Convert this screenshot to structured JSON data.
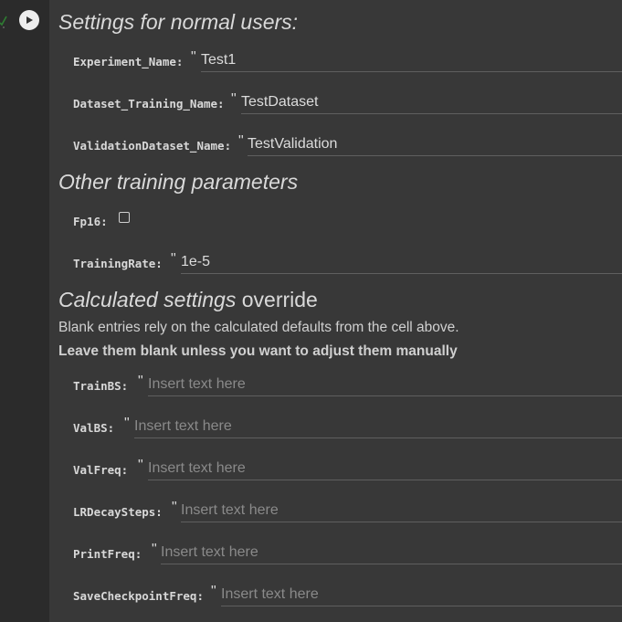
{
  "headings": {
    "normal_settings": "Settings for normal users:",
    "training_params": "Other training parameters",
    "calculated_italic": "Calculated settings",
    "calculated_plain": " override"
  },
  "descriptions": {
    "blank_entries": "Blank entries rely on the calculated defaults from the cell above.",
    "leave_blank": "Leave them blank unless you want to adjust them manually"
  },
  "quote_mark": "\"",
  "fields": {
    "experiment_name": {
      "label": "Experiment_Name:",
      "value": "Test1"
    },
    "dataset_training_name": {
      "label": "Dataset_Training_Name:",
      "value": "TestDataset"
    },
    "validation_dataset_name": {
      "label": "ValidationDataset_Name:",
      "value": "TestValidation"
    },
    "fp16": {
      "label": "Fp16:",
      "checked": false
    },
    "training_rate": {
      "label": "TrainingRate:",
      "value": "1e-5"
    },
    "train_bs": {
      "label": "TrainBS:",
      "value": "",
      "placeholder": "Insert text here"
    },
    "val_bs": {
      "label": "ValBS:",
      "value": "",
      "placeholder": "Insert text here"
    },
    "val_freq": {
      "label": "ValFreq:",
      "value": "",
      "placeholder": "Insert text here"
    },
    "lr_decay_steps": {
      "label": "LRDecaySteps:",
      "value": "",
      "placeholder": "Insert text here"
    },
    "print_freq": {
      "label": "PrintFreq:",
      "value": "",
      "placeholder": "Insert text here"
    },
    "save_checkpoint_freq": {
      "label": "SaveCheckpointFreq:",
      "value": "",
      "placeholder": "Insert text here"
    }
  },
  "icons": {
    "run": "play-icon",
    "status": "checkmark-icon"
  },
  "colors": {
    "background": "#383838",
    "gutter": "#2b2b2b",
    "run_button": "#eeeeee",
    "status_check": "#2e7d32"
  }
}
